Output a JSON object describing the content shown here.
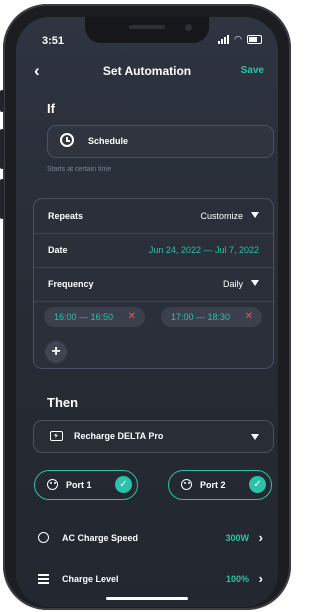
{
  "status": {
    "time": "3:51"
  },
  "header": {
    "title": "Set Automation",
    "save_label": "Save",
    "back_icon": "chevron-left-icon"
  },
  "if_section": {
    "label": "If",
    "trigger": {
      "label": "Schedule",
      "icon": "alarm-clock-icon",
      "hint": "Starts at certain time"
    },
    "repeats": {
      "label": "Repeats",
      "value": "Customize"
    },
    "date": {
      "label": "Date",
      "value": "Jun 24, 2022 — Jul 7, 2022"
    },
    "frequency": {
      "label": "Frequency",
      "value": "Daily"
    },
    "time_slots": [
      {
        "label": "16:00 — 16:50"
      },
      {
        "label": "17:00 — 18:30"
      }
    ],
    "add_label": "+"
  },
  "then_section": {
    "label": "Then",
    "action": {
      "label": "Recharge DELTA Pro",
      "icon": "charge-icon"
    },
    "ports": [
      {
        "label": "Port 1",
        "checked": true
      },
      {
        "label": "Port 2",
        "checked": true
      }
    ],
    "settings": [
      {
        "label": "AC Charge Speed",
        "value": "300W",
        "icon": "gauge-icon"
      },
      {
        "label": "Charge Level",
        "value": "100%",
        "icon": "sliders-icon"
      }
    ]
  },
  "colors": {
    "accent": "#2cc1a9",
    "remove": "#e45656",
    "background": "#2b303a"
  }
}
